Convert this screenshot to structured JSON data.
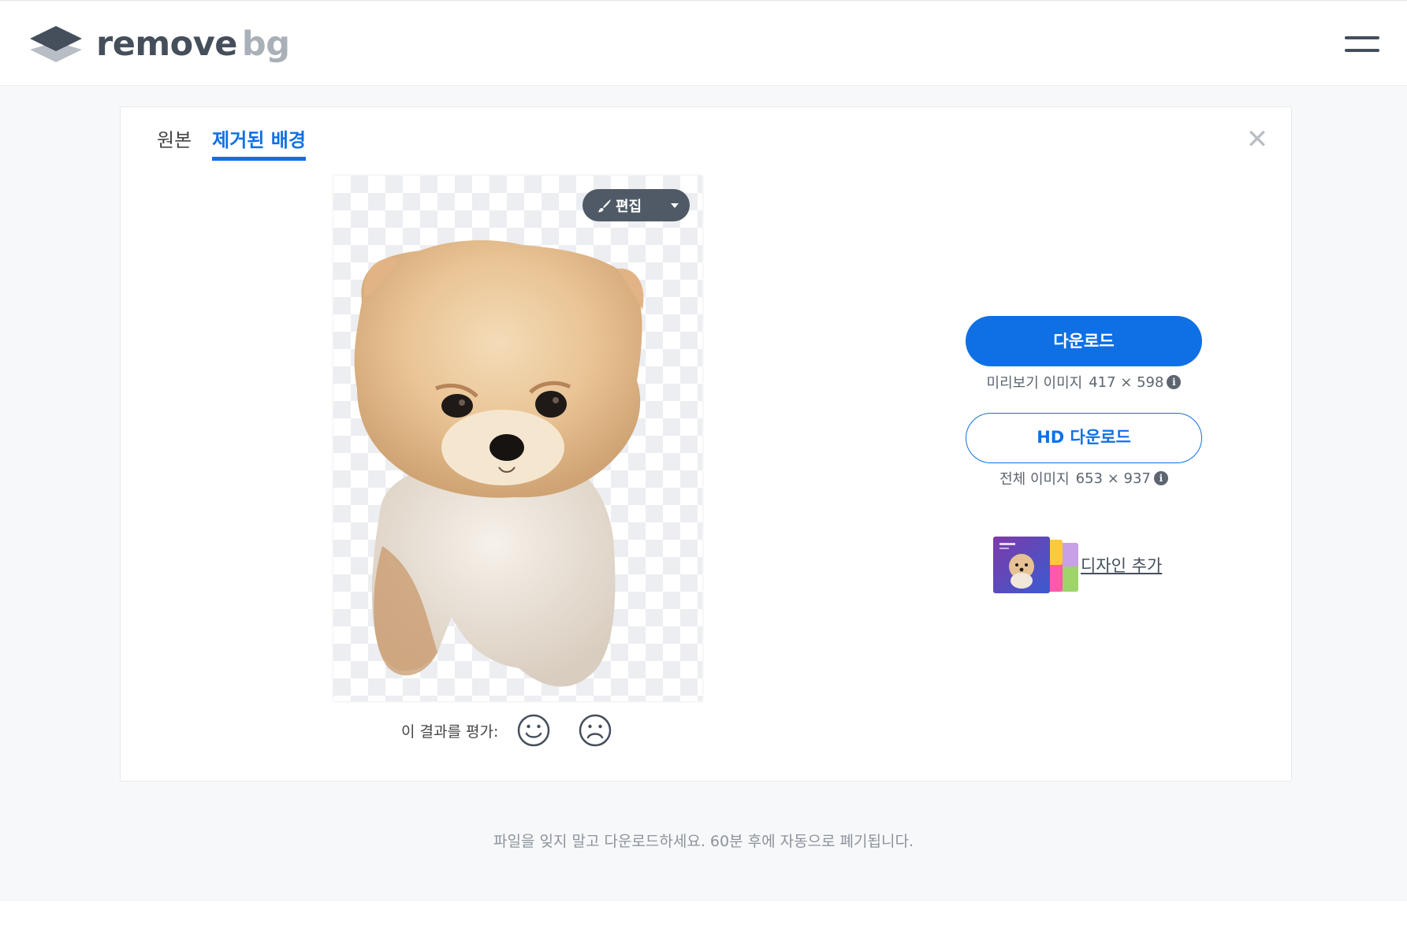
{
  "header": {
    "logo_primary": "remove",
    "logo_secondary": "bg",
    "menu_icon": "hamburger-menu-icon"
  },
  "tabs": [
    {
      "label": "원본",
      "active": false
    },
    {
      "label": "제거된 배경",
      "active": true
    }
  ],
  "preview": {
    "edit_label": "편집",
    "edit_icon": "brush-icon",
    "rating_prompt": "이 결과를 평가:",
    "positive_icon": "smile-icon",
    "negative_icon": "frown-icon"
  },
  "download": {
    "label": "다운로드",
    "info_label": "미리보기 이미지",
    "dimensions": "417 × 598"
  },
  "hd_download": {
    "label": "HD 다운로드",
    "info_label": "전체 이미지",
    "dimensions": "653 × 937"
  },
  "design": {
    "label": "디자인 추가"
  },
  "footer": {
    "note": "파일을 잊지 말고 다운로드하세요. 60분 후에 자동으로 폐기됩니다."
  },
  "colors": {
    "accent": "#0f70e6",
    "logo_dark": "#454f5c",
    "logo_light": "#a9b0b8",
    "edit_button": "#4f5a66"
  }
}
